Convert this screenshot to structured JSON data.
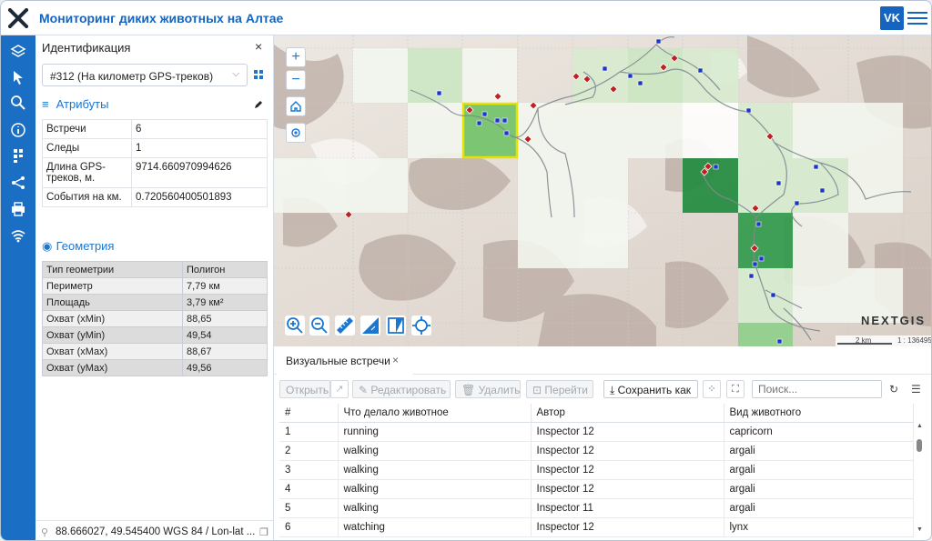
{
  "app": {
    "title": "Мониторинг диких животных на Алтае",
    "user_initials": "VK",
    "accent": "#1a6ec4"
  },
  "rail": {
    "icons": [
      "layers-icon",
      "select-cursor-icon",
      "search-icon",
      "info-icon",
      "identify-icon",
      "share-icon",
      "print-icon",
      "wifi-icon"
    ]
  },
  "panel": {
    "title": "Идентификация",
    "close": "×",
    "selected_object": "#312 (На километр GPS-треков)",
    "attributes_title": "Атрибуты",
    "attributes": [
      {
        "key": "Встречи",
        "value": "6"
      },
      {
        "key": "Следы",
        "value": "1"
      },
      {
        "key": "Длина GPS-треков, м.",
        "value": "9714.660970994626"
      },
      {
        "key": "События на км.",
        "value": "0.720560400501893"
      }
    ],
    "geometry_title": "Геометрия",
    "geometry": [
      {
        "key": "Тип геометрии",
        "value": "Полигон"
      },
      {
        "key": "Периметр",
        "value": "7,79 км"
      },
      {
        "key": "Площадь",
        "value": "3,79 км²"
      },
      {
        "key": "Охват (xMin)",
        "value": "88,65"
      },
      {
        "key": "Охват (yMin)",
        "value": "49,54"
      },
      {
        "key": "Охват (xMax)",
        "value": "88,67"
      },
      {
        "key": "Охват (yMax)",
        "value": "49,56"
      }
    ],
    "coordinates": "88.666027, 49.545400 WGS 84 / Lon-lat ..."
  },
  "map": {
    "brand": "NEXTGIS",
    "scale_label": "2 km",
    "scale_ratio": "1 : 136495",
    "zoom_in": "+",
    "zoom_out": "−"
  },
  "table": {
    "tab_label": "Визуальные встречи",
    "tab_close": "×",
    "toolbar": {
      "open": "Открыть",
      "edit": "Редактировать",
      "delete": "Удалить",
      "goto": "Перейти",
      "save_as": "Сохранить как",
      "search_placeholder": "Поиск..."
    },
    "columns": [
      "#",
      "Что делало животное",
      "Автор",
      "Вид животного"
    ],
    "rows": [
      [
        "1",
        "running",
        "Inspector 12",
        "capricorn"
      ],
      [
        "2",
        "walking",
        "Inspector 12",
        "argali"
      ],
      [
        "3",
        "walking",
        "Inspector 12",
        "argali"
      ],
      [
        "4",
        "walking",
        "Inspector 12",
        "argali"
      ],
      [
        "5",
        "walking",
        "Inspector 11",
        "argali"
      ],
      [
        "6",
        "watching",
        "Inspector 12",
        "lynx"
      ]
    ]
  }
}
